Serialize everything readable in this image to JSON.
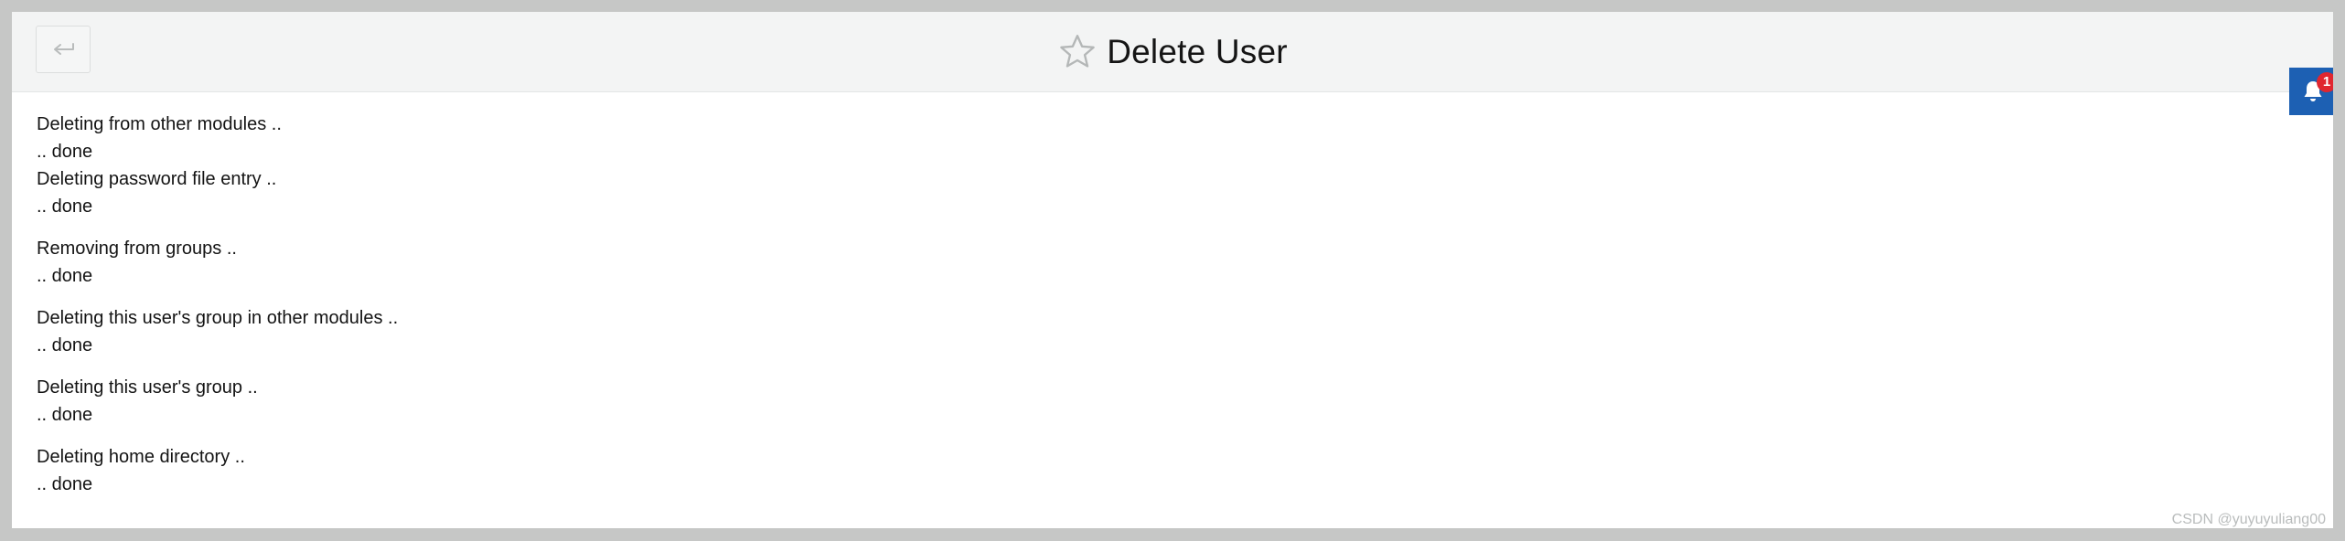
{
  "header": {
    "title": "Delete User",
    "back_icon": "back-arrow-icon",
    "star_icon": "star-outline-icon"
  },
  "log": {
    "groups": [
      {
        "lines": [
          "Deleting from other modules ..",
          ".. done"
        ]
      },
      {
        "lines": [
          "Deleting password file entry ..",
          ".. done"
        ]
      },
      {
        "lines": [
          "Removing from groups ..",
          ".. done"
        ]
      },
      {
        "lines": [
          "Deleting this user's group in other modules ..",
          ".. done"
        ]
      },
      {
        "lines": [
          "Deleting this user's group ..",
          ".. done"
        ]
      },
      {
        "lines": [
          "Deleting home directory ..",
          ".. done"
        ]
      }
    ]
  },
  "notifications": {
    "icon": "bell-icon",
    "count": "1",
    "color": "#1d60b3",
    "badge_color": "#e0262f"
  },
  "watermark": "CSDN @yuyuyuliang00"
}
